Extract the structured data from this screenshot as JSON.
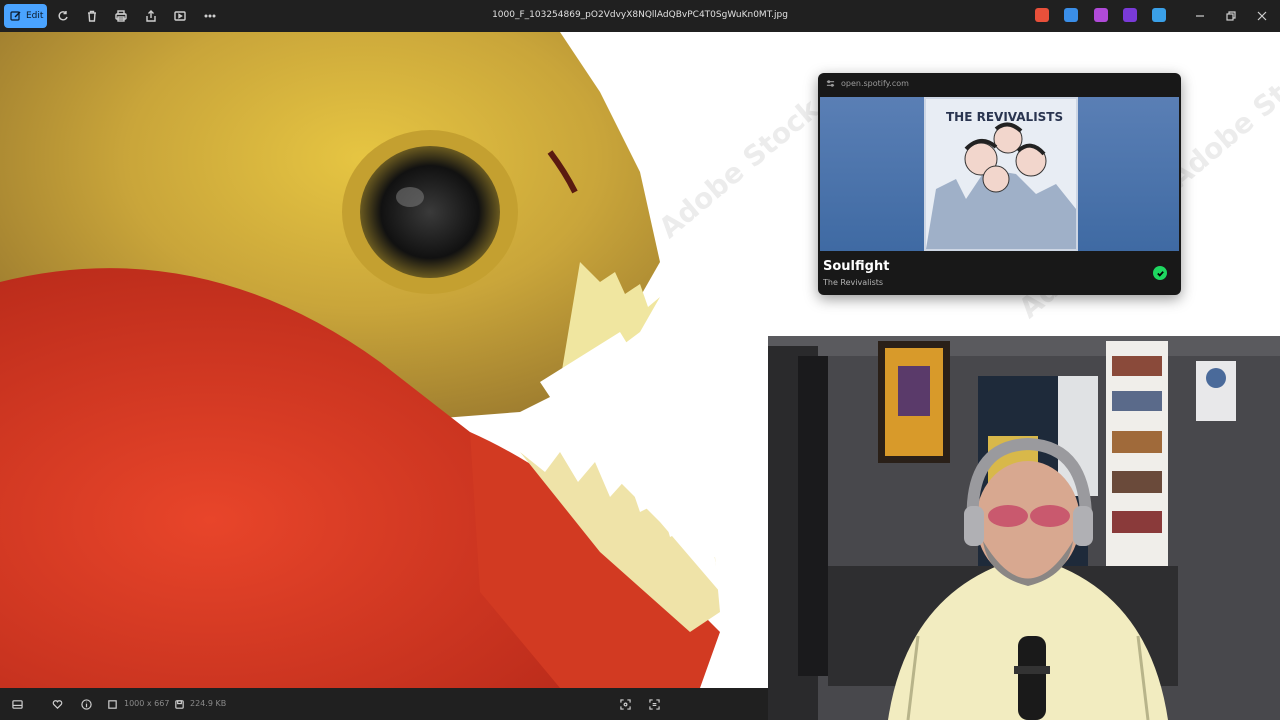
{
  "toolbar": {
    "edit_label": "Edit",
    "filename": "1000_F_103254869_pO2VdvyX8NQllAdQBvPC4T0SgWuKn0MT.jpg",
    "icons": [
      "rotate-icon",
      "delete-icon",
      "print-icon",
      "share-icon",
      "slideshow-icon",
      "more-icon"
    ]
  },
  "tray_colors": [
    "#e8503a",
    "#3a8ee8",
    "#b04ad8",
    "#7a3ad8",
    "#3aa0e8"
  ],
  "photo": {
    "watermark": "Adobe Stock"
  },
  "spotify": {
    "url": "open.spotify.com",
    "track_title": "Soulfight",
    "artist": "The Revivalists",
    "album_text": "THE REVIVALISTS",
    "accent": "#1ed760"
  },
  "statusbar": {
    "dimensions": "1000 x 667",
    "file_size": "224.9 KB"
  }
}
